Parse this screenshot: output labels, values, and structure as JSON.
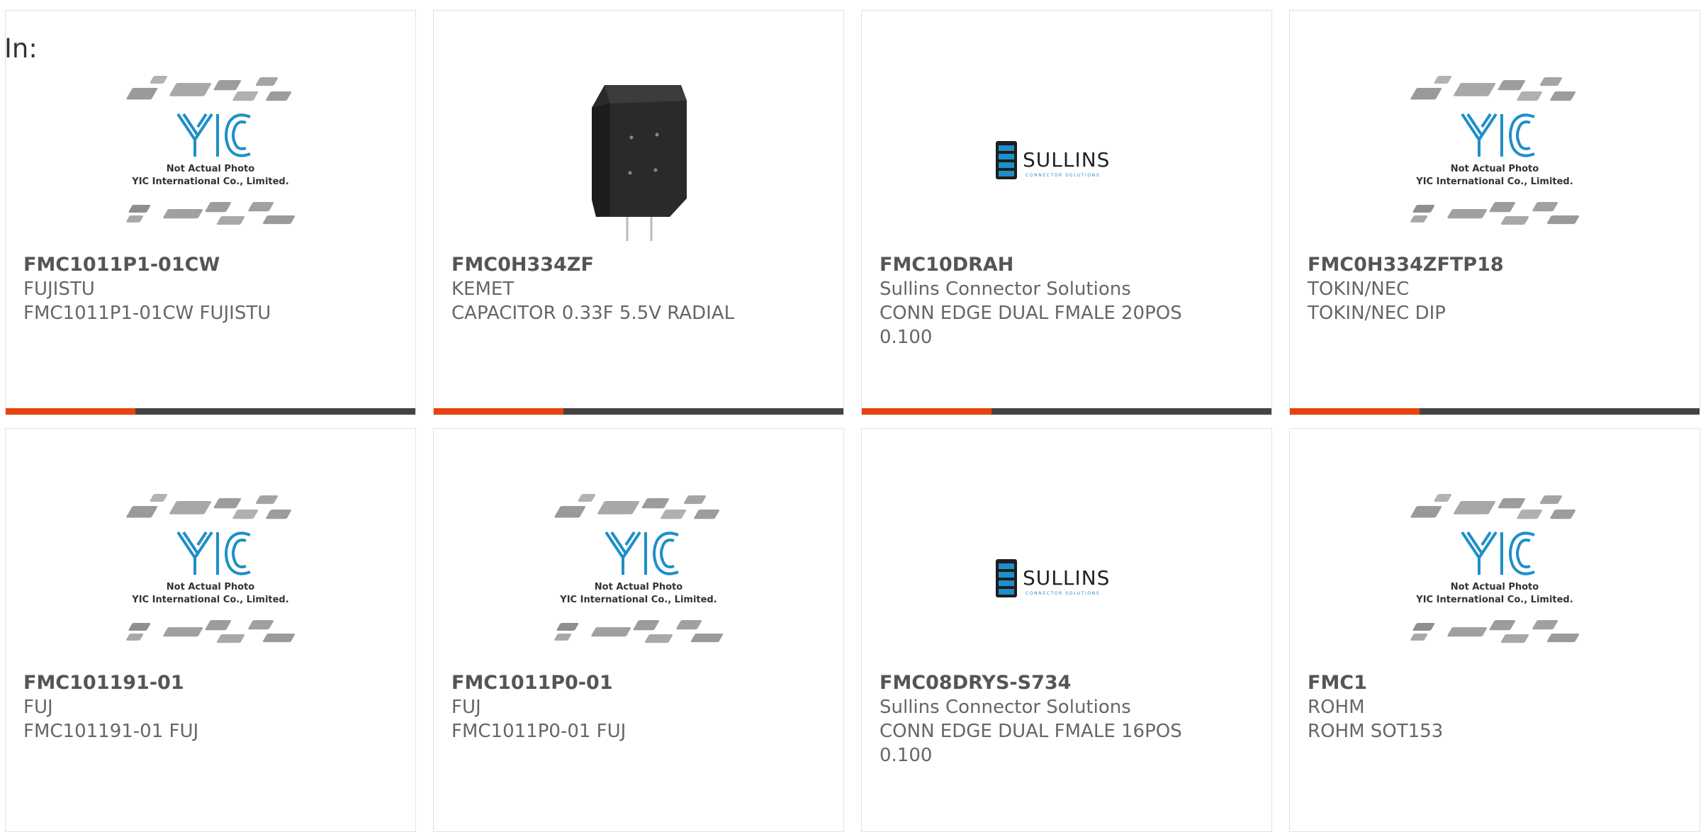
{
  "heading": "In:",
  "products": [
    {
      "part": "FMC1011P1-01CW",
      "maker": "FUJISTU",
      "desc": "FMC1011P1-01CW FUJISTU",
      "image": "not-actual-photo",
      "placeholder": {
        "line1": "Not Actual Photo",
        "line2": "YIC International Co., Limited."
      }
    },
    {
      "part": "FMC0H334ZF",
      "maker": "KEMET",
      "desc": "CAPACITOR 0.33F 5.5V RADIAL",
      "image": "capacitor-photo"
    },
    {
      "part": "FMC10DRAH",
      "maker": "Sullins Connector Solutions",
      "desc": "CONN EDGE DUAL FMALE 20POS 0.100",
      "image": "sullins-logo",
      "logo": {
        "name": "SULLINS",
        "tag": "CONNECTOR SOLUTIONS"
      }
    },
    {
      "part": "FMC0H334ZFTP18",
      "maker": "TOKIN/NEC",
      "desc": "TOKIN/NEC DIP",
      "image": "not-actual-photo",
      "placeholder": {
        "line1": "Not Actual Photo",
        "line2": "YIC International Co., Limited."
      }
    },
    {
      "part": "FMC101191-01",
      "maker": "FUJ",
      "desc": "FMC101191-01 FUJ",
      "image": "not-actual-photo",
      "placeholder": {
        "line1": "Not Actual Photo",
        "line2": "YIC International Co., Limited."
      }
    },
    {
      "part": "FMC1011P0-01",
      "maker": "FUJ",
      "desc": "FMC1011P0-01 FUJ",
      "image": "not-actual-photo",
      "placeholder": {
        "line1": "Not Actual Photo",
        "line2": "YIC International Co., Limited."
      }
    },
    {
      "part": "FMC08DRYS-S734",
      "maker": "Sullins Connector Solutions",
      "desc": "CONN EDGE DUAL FMALE 16POS 0.100",
      "image": "sullins-logo",
      "logo": {
        "name": "SULLINS",
        "tag": "CONNECTOR SOLUTIONS"
      }
    },
    {
      "part": "FMC1",
      "maker": "ROHM",
      "desc": "ROHM SOT153",
      "image": "not-actual-photo",
      "placeholder": {
        "line1": "Not Actual Photo",
        "line2": "YIC International Co., Limited."
      }
    }
  ],
  "colors": {
    "accent": "#e8420c",
    "bar": "#444444",
    "logo_blue": "#1e8fc9"
  }
}
